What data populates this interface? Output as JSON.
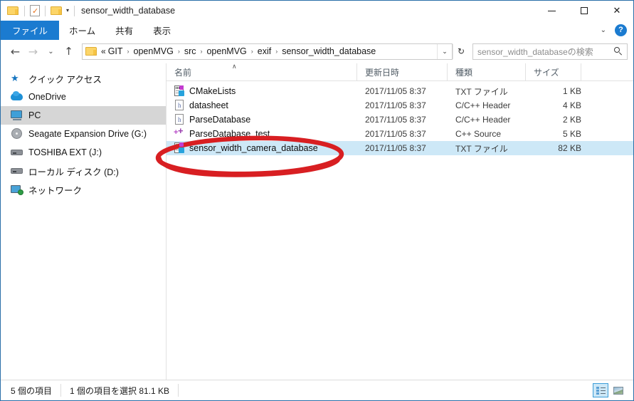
{
  "window": {
    "title": "sensor_width_database",
    "quick_access": [
      {
        "name": "folder-icon",
        "label": ""
      },
      {
        "name": "properties-icon",
        "label": ""
      },
      {
        "name": "new-folder-icon",
        "label": ""
      },
      {
        "name": "customize-quick-access-caret",
        "label": "▾"
      }
    ],
    "controls": {
      "minimize": "─",
      "maximize": "□",
      "close": "✕"
    }
  },
  "ribbon": {
    "tabs": [
      {
        "label": "ファイル",
        "active": true
      },
      {
        "label": "ホーム",
        "active": false
      },
      {
        "label": "共有",
        "active": false
      },
      {
        "label": "表示",
        "active": false
      }
    ],
    "expand_caret": "⌄",
    "help_label": "?"
  },
  "navbar": {
    "back": "←",
    "forward": "→",
    "recent_caret": "⌄",
    "up": "↑",
    "overflow": "«",
    "separator": "›",
    "crumbs": [
      "GIT",
      "openMVG",
      "src",
      "openMVG",
      "exif",
      "sensor_width_database"
    ],
    "address_caret": "⌄",
    "refresh": "↻"
  },
  "search": {
    "placeholder": "sensor_width_databaseの検索",
    "icon": "search-icon"
  },
  "sidebar": {
    "items": [
      {
        "label": "クイック アクセス",
        "icon": "star-icon",
        "selected": false
      },
      {
        "label": "OneDrive",
        "icon": "cloud-icon",
        "selected": false
      },
      {
        "label": "PC",
        "icon": "computer-icon",
        "selected": true
      },
      {
        "label": "Seagate Expansion Drive (G:)",
        "icon": "disc-drive-icon",
        "selected": false
      },
      {
        "label": "TOSHIBA EXT (J:)",
        "icon": "hard-drive-icon",
        "selected": false
      },
      {
        "label": "ローカル ディスク (D:)",
        "icon": "hard-drive-icon",
        "selected": false
      },
      {
        "label": "ネットワーク",
        "icon": "network-icon",
        "selected": false
      }
    ]
  },
  "filelist": {
    "columns": [
      {
        "label": "名前",
        "sorted": "asc",
        "sort_glyph": "∧"
      },
      {
        "label": "更新日時"
      },
      {
        "label": "種類"
      },
      {
        "label": "サイズ"
      }
    ],
    "rows": [
      {
        "name": "CMakeLists",
        "modified": "2017/11/05 8:37",
        "type": "TXT ファイル",
        "size": "1 KB",
        "icon": "txt-file-icon",
        "selected": false
      },
      {
        "name": "datasheet",
        "modified": "2017/11/05 8:37",
        "type": "C/C++ Header",
        "size": "4 KB",
        "icon": "header-file-icon",
        "selected": false
      },
      {
        "name": "ParseDatabase",
        "modified": "2017/11/05 8:37",
        "type": "C/C++ Header",
        "size": "2 KB",
        "icon": "header-file-icon",
        "selected": false
      },
      {
        "name": "ParseDatabase_test",
        "modified": "2017/11/05 8:37",
        "type": "C++ Source",
        "size": "5 KB",
        "icon": "cpp-source-file-icon",
        "selected": false
      },
      {
        "name": "sensor_width_camera_database",
        "modified": "2017/11/05 8:37",
        "type": "TXT ファイル",
        "size": "82 KB",
        "icon": "txt-file-icon",
        "selected": true
      }
    ]
  },
  "statusbar": {
    "item_count": "5 個の項目",
    "selection_info": "1 個の項目を選択  81.1 KB",
    "views": [
      {
        "name": "details-view-button",
        "active": true
      },
      {
        "name": "large-icons-view-button",
        "active": false
      }
    ]
  },
  "annotation": {
    "shape": "ellipse",
    "color": "#d81f22",
    "target": "sensor_width_camera_database"
  },
  "colors": {
    "accent": "#1b7bd0",
    "selection": "#cde8f7",
    "sidebar_selection": "#d6d6d6",
    "annotation_red": "#d81f22"
  }
}
